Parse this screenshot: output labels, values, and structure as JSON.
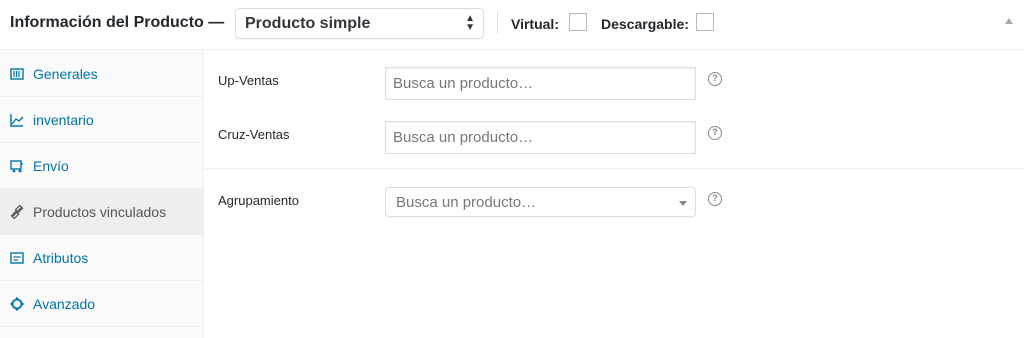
{
  "header": {
    "title": "Información del Producto —",
    "product_type": "Producto simple",
    "virtual_label": "Virtual:",
    "download_label": "Descargable:"
  },
  "sidebar": {
    "items": [
      {
        "label": "Generales",
        "icon": "general-icon",
        "active": false
      },
      {
        "label": "inventario",
        "icon": "inventory-icon",
        "active": false
      },
      {
        "label": "Envío",
        "icon": "shipping-icon",
        "active": false
      },
      {
        "label": "Productos vinculados",
        "icon": "link-icon",
        "active": true
      },
      {
        "label": "Atributos",
        "icon": "attributes-icon",
        "active": false
      },
      {
        "label": "Avanzado",
        "icon": "advanced-icon",
        "active": false
      }
    ]
  },
  "fields": {
    "upsells": {
      "label": "Up-Ventas",
      "placeholder": "Busca un producto…"
    },
    "crosssells": {
      "label": "Cruz-Ventas",
      "placeholder": "Busca un producto…"
    },
    "grouping": {
      "label": "Agrupamiento",
      "placeholder": "Busca un producto…"
    }
  },
  "help_icon_glyph": "?",
  "colors": {
    "link": "#0073aa",
    "active_tab_bg": "#eeeeee",
    "border": "#dddddd"
  }
}
